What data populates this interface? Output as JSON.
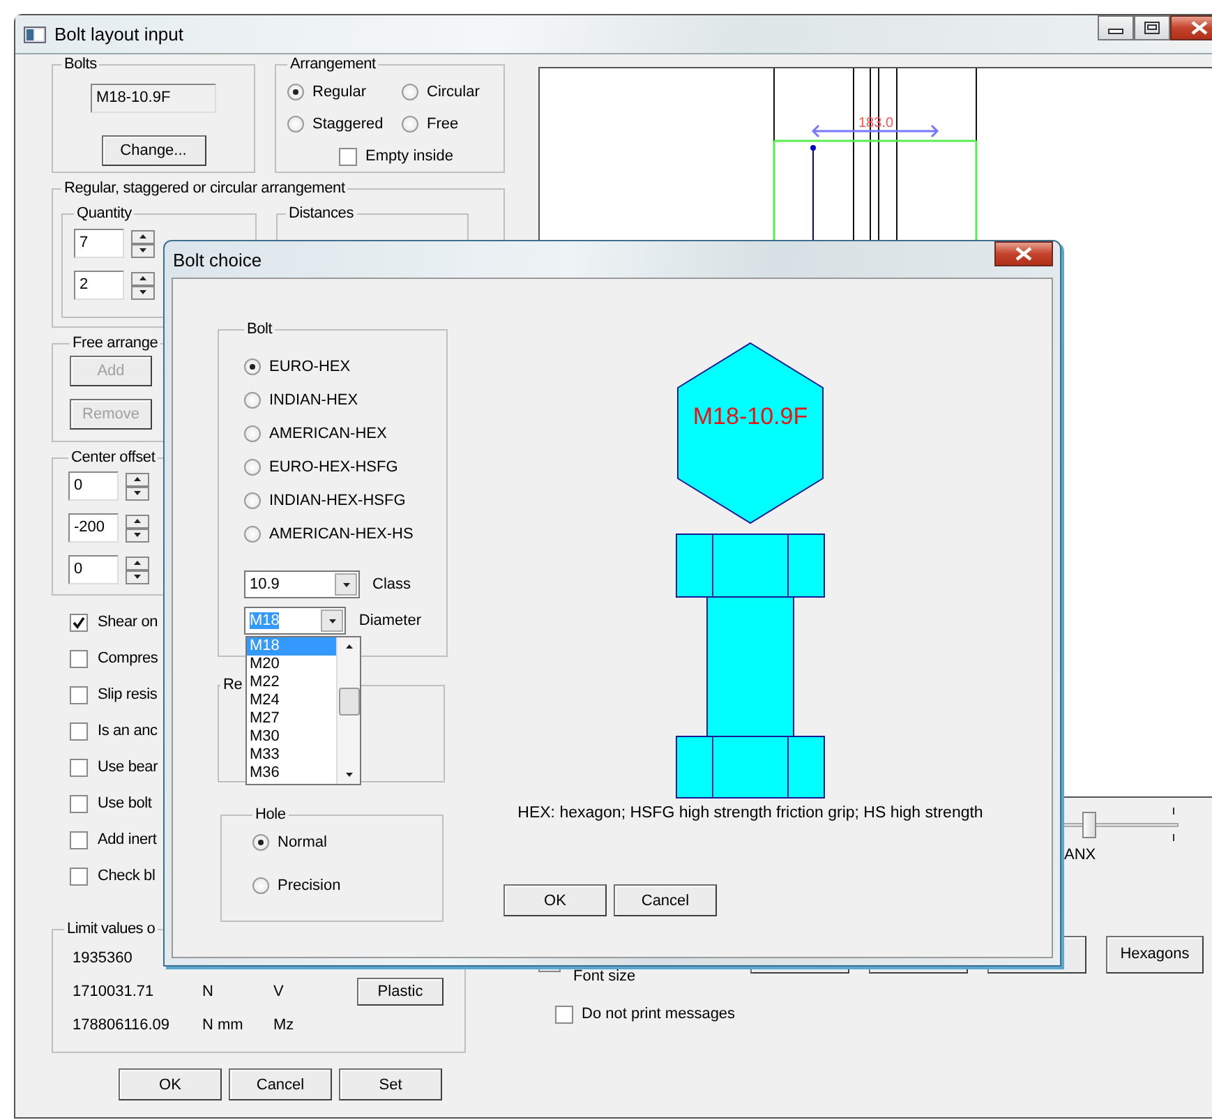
{
  "window": {
    "title": "Bolt layout input"
  },
  "bolts": {
    "title": "Bolts",
    "value": "M18-10.9F",
    "button": "Change..."
  },
  "arrangement": {
    "title": "Arrangement",
    "options": [
      {
        "label": "Regular",
        "selected": true
      },
      {
        "label": "Circular",
        "selected": false
      },
      {
        "label": "Staggered",
        "selected": false
      },
      {
        "label": "Free",
        "selected": false
      }
    ],
    "empty_inside": {
      "label": "Empty inside",
      "checked": false
    }
  },
  "regular_group": {
    "title": "Regular, staggered or circular arrangement",
    "quantity": {
      "title": "Quantity",
      "values": [
        "7",
        "2"
      ]
    },
    "distances": {
      "title": "Distances"
    }
  },
  "free_group": {
    "title": "Free arrange",
    "buttons": [
      {
        "label": "Add",
        "disabled": true
      },
      {
        "label": "Remove",
        "disabled": true
      }
    ]
  },
  "center_offset": {
    "title": "Center offset",
    "values": [
      "0",
      "-200",
      "0"
    ]
  },
  "options": [
    {
      "label": "Shear on",
      "checked": true
    },
    {
      "label": "Compres",
      "checked": false
    },
    {
      "label": "Slip resis",
      "checked": false
    },
    {
      "label": "Is an anc",
      "checked": false
    },
    {
      "label": "Use bear",
      "checked": false
    },
    {
      "label": "Use bolt",
      "checked": false
    },
    {
      "label": "Add inert",
      "checked": false
    },
    {
      "label": "Check bl",
      "checked": false
    }
  ],
  "limit_values": {
    "title": "Limit values o",
    "rows": [
      {
        "value": "1935360"
      },
      {
        "value": "1710031.71",
        "unit": "N",
        "name": "V",
        "button": "Plastic"
      },
      {
        "value": "178806116.09",
        "unit": "N mm",
        "name": "Mz"
      }
    ]
  },
  "buttons": [
    "OK",
    "Cancel",
    "Set"
  ],
  "canvas": {
    "dimension": "183.0"
  },
  "slider": {
    "label": "ANX",
    "level": 0.25
  },
  "font_size": {
    "label": "Font size"
  },
  "tool_buttons": [
    "Hexagons"
  ],
  "do_not_print": {
    "label": "Do not print messages",
    "checked": false
  },
  "dialog": {
    "title": "Bolt choice",
    "bolt_group": {
      "title": "Bolt",
      "types": [
        {
          "label": "EURO-HEX",
          "selected": true
        },
        {
          "label": "INDIAN-HEX",
          "selected": false
        },
        {
          "label": "AMERICAN-HEX",
          "selected": false
        },
        {
          "label": "EURO-HEX-HSFG",
          "selected": false
        },
        {
          "label": "INDIAN-HEX-HSFG",
          "selected": false
        },
        {
          "label": "AMERICAN-HEX-HS",
          "selected": false
        }
      ],
      "class": {
        "value": "10.9",
        "label": "Class"
      },
      "diameter": {
        "value": "M18",
        "label": "Diameter",
        "options": [
          {
            "label": "M18",
            "selected": true
          },
          {
            "label": "M20",
            "selected": false
          },
          {
            "label": "M22",
            "selected": false
          },
          {
            "label": "M24",
            "selected": false
          },
          {
            "label": "M27",
            "selected": false
          },
          {
            "label": "M30",
            "selected": false
          },
          {
            "label": "M33",
            "selected": false
          },
          {
            "label": "M36",
            "selected": false
          }
        ]
      }
    },
    "re_group": {
      "title": "Re"
    },
    "hole": {
      "title": "Hole",
      "options": [
        {
          "label": "Normal",
          "selected": true
        },
        {
          "label": "Precision",
          "selected": false
        }
      ]
    },
    "preview_label": "M18-10.9F",
    "legend": "HEX: hexagon; HSFG high strength friction grip; HS high strength",
    "buttons": [
      "OK",
      "Cancel"
    ]
  }
}
